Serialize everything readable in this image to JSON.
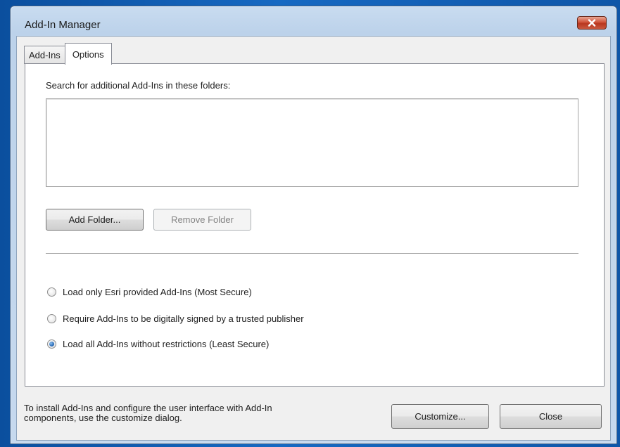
{
  "window": {
    "title": "Add-In Manager"
  },
  "tabs": [
    {
      "label": "Add-Ins",
      "selected": false
    },
    {
      "label": "Options",
      "selected": true
    }
  ],
  "options": {
    "search_label": "Search for additional Add-Ins in these folders:",
    "folders": [],
    "add_folder_label": "Add Folder...",
    "remove_folder_label": "Remove Folder",
    "remove_folder_enabled": false,
    "radios": [
      {
        "label": "Load only Esri provided Add-Ins (Most Secure)",
        "checked": false
      },
      {
        "label": "Require Add-Ins to be digitally signed by a trusted publisher",
        "checked": false
      },
      {
        "label": "Load all Add-Ins without restrictions (Least Secure)",
        "checked": true
      }
    ]
  },
  "footer": {
    "info_line1": "To install Add-Ins and configure the user interface with Add-In",
    "info_line2": "components, use the customize dialog.",
    "customize_label": "Customize...",
    "close_label": "Close"
  },
  "icons": {
    "close": "close-icon"
  },
  "colors": {
    "close_button": "#c9452c",
    "radio_selected": "#2a6cb8",
    "desktop": "#1669c2"
  }
}
